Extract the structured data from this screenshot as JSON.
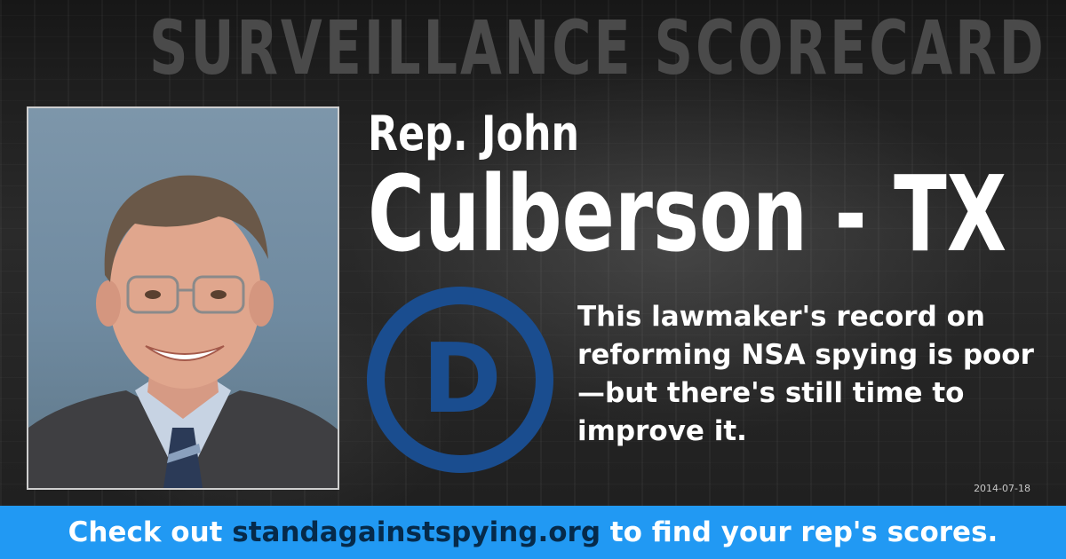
{
  "banner": {
    "text": "SURVEILLANCE SCORECARD"
  },
  "representative": {
    "title_line": "Rep. John",
    "name_line": "Culberson - TX",
    "photo_desc_icon": "portrait-photo"
  },
  "party": {
    "letter": "D",
    "color": "#1a4d8f"
  },
  "message": {
    "text": "This lawmaker's record on reforming NSA spying is poor—but there's still time to improve it."
  },
  "date": {
    "text": "2014-07-18"
  },
  "footer": {
    "prefix": "Check out ",
    "url": "standagainstspying.org",
    "suffix": " to find your rep's scores.",
    "background": "#2199f3",
    "url_color": "#062a4a"
  }
}
